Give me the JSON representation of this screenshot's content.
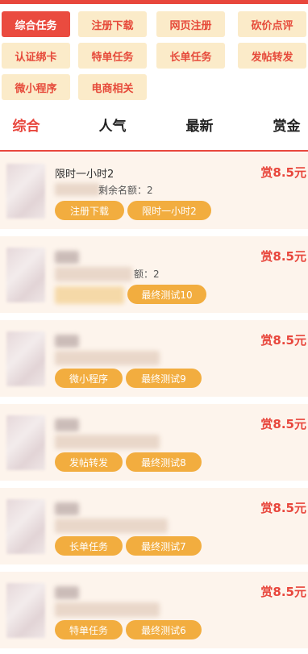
{
  "categories": [
    {
      "label": "综合任务",
      "active": true
    },
    {
      "label": "注册下载",
      "active": false
    },
    {
      "label": "网页注册",
      "active": false
    },
    {
      "label": "砍价点评",
      "active": false
    },
    {
      "label": "认证绑卡",
      "active": false
    },
    {
      "label": "特单任务",
      "active": false
    },
    {
      "label": "长单任务",
      "active": false
    },
    {
      "label": "发帖转发",
      "active": false
    },
    {
      "label": "微小程序",
      "active": false
    },
    {
      "label": "电商相关",
      "active": false
    }
  ],
  "sort_tabs": [
    {
      "label": "综合",
      "active": true
    },
    {
      "label": "人气",
      "active": false
    },
    {
      "label": "最新",
      "active": false
    },
    {
      "label": "赏金",
      "active": false
    }
  ],
  "tasks": [
    {
      "title": "限时一小时2",
      "remaining": "剩余名额：2",
      "reward": "赏8.5元",
      "tags": [
        "注册下载",
        "限时一小时2"
      ]
    },
    {
      "title": "",
      "remaining": "额：2",
      "reward": "赏8.5元",
      "tags": [
        "",
        "最终测试10"
      ]
    },
    {
      "title": "",
      "remaining": "",
      "reward": "赏8.5元",
      "tags": [
        "微小程序",
        "最终测试9"
      ]
    },
    {
      "title": "",
      "remaining": "",
      "reward": "赏8.5元",
      "tags": [
        "发帖转发",
        "最终测试8"
      ]
    },
    {
      "title": "",
      "remaining": "",
      "reward": "赏8.5元",
      "tags": [
        "长单任务",
        "最终测试7"
      ]
    },
    {
      "title": "",
      "remaining": "",
      "reward": "赏8.5元",
      "tags": [
        "特单任务",
        "最终测试6"
      ]
    }
  ]
}
